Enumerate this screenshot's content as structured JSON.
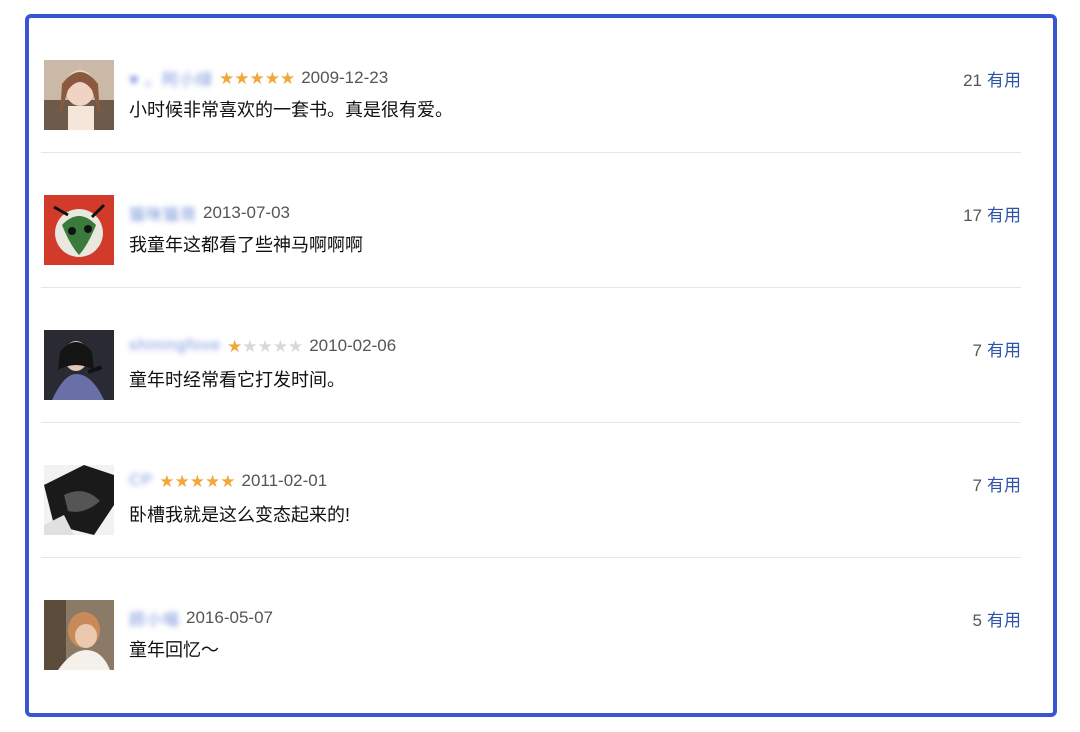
{
  "useful_label": "有用",
  "colors": {
    "frame": "#3a55d4",
    "star": "#f2a73b",
    "link": "#2d54a7"
  },
  "comments": [
    {
      "user": "♥ 。阿小绿",
      "rating": 5,
      "date": "2009-12-23",
      "text": "小时候非常喜欢的一套书。真是很有爱。",
      "useful": "21",
      "avatar_icon": "woman-portrait-avatar"
    },
    {
      "user": "猫咪猫哥",
      "rating": 0,
      "date": "2013-07-03",
      "text": "我童年这都看了些神马啊啊啊",
      "useful": "17",
      "avatar_icon": "red-illustration-avatar"
    },
    {
      "user": "shiningfove",
      "rating": 1,
      "date": "2010-02-06",
      "text": "童年时经常看它打发时间。",
      "useful": "7",
      "avatar_icon": "singer-portrait-avatar"
    },
    {
      "user": "CP",
      "rating": 5,
      "date": "2011-02-01",
      "text": "卧槽我就是这么变态起来的!",
      "useful": "7",
      "avatar_icon": "dark-silhouette-avatar"
    },
    {
      "user": "顾小喵",
      "rating": 0,
      "date": "2016-05-07",
      "text": "童年回忆～",
      "useful": "5",
      "avatar_icon": "photo-portrait-avatar"
    }
  ]
}
